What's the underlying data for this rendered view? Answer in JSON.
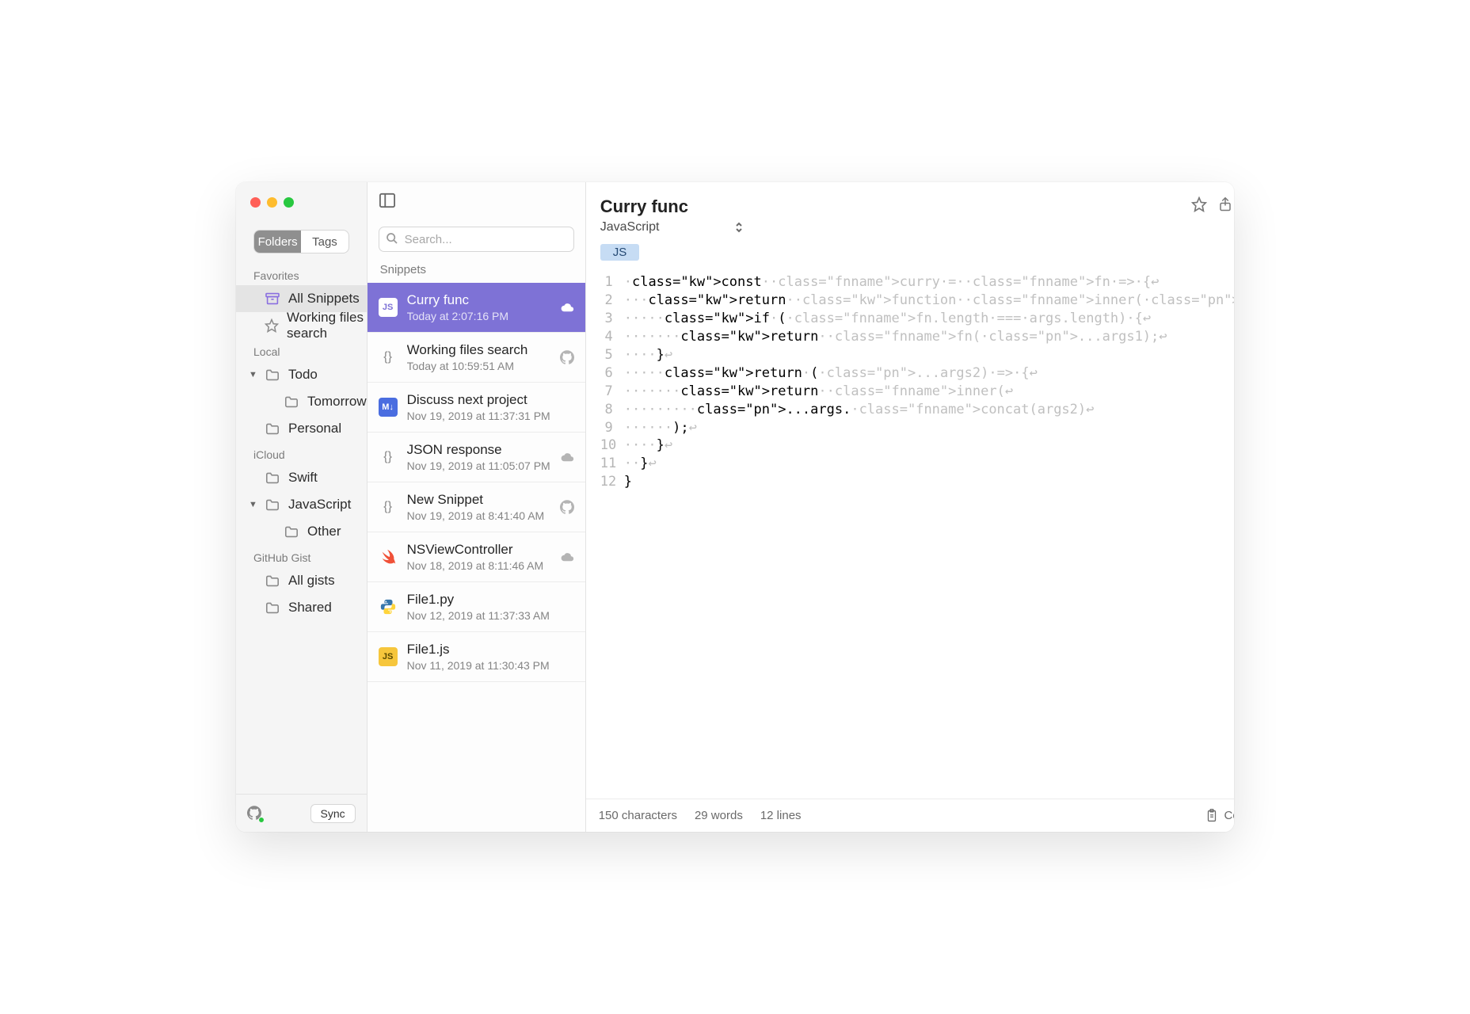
{
  "sidebar": {
    "tabs": {
      "folders": "Folders",
      "tags": "Tags"
    },
    "sections": {
      "favorites": "Favorites",
      "local": "Local",
      "icloud": "iCloud",
      "gist": "GitHub Gist"
    },
    "favorites": [
      {
        "label": "All Snippets",
        "icon": "box"
      },
      {
        "label": "Working files search",
        "icon": "star"
      }
    ],
    "local": [
      {
        "label": "Todo",
        "expandable": true,
        "expanded": true
      },
      {
        "label": "Tomorrow",
        "level": 2
      },
      {
        "label": "Personal",
        "level": 1
      }
    ],
    "icloud": [
      {
        "label": "Swift"
      },
      {
        "label": "JavaScript",
        "expandable": true,
        "expanded": true
      },
      {
        "label": "Other",
        "level": 2
      }
    ],
    "gist": [
      {
        "label": "All gists"
      },
      {
        "label": "Shared"
      }
    ],
    "sync_label": "Sync"
  },
  "list": {
    "search_placeholder": "Search...",
    "header": "Snippets",
    "items": [
      {
        "title": "Curry func",
        "sub": "Today at 2:07:16 PM",
        "badge": "js",
        "badge_text": "JS",
        "glyph": "cloud",
        "selected": true
      },
      {
        "title": "Working files search",
        "sub": "Today at 10:59:51 AM",
        "badge": "braces",
        "badge_text": "{}",
        "glyph": "github"
      },
      {
        "title": "Discuss next project",
        "sub": "Nov 19, 2019 at 11:37:31 PM",
        "badge": "md",
        "badge_text": "M↓"
      },
      {
        "title": "JSON response",
        "sub": "Nov 19, 2019 at 11:05:07 PM",
        "badge": "braces",
        "badge_text": "{}",
        "glyph": "cloud"
      },
      {
        "title": "New Snippet",
        "sub": "Nov 19, 2019 at 8:41:40 AM",
        "badge": "braces",
        "badge_text": "{}",
        "glyph": "github"
      },
      {
        "title": "NSViewController",
        "sub": "Nov 18, 2019 at 8:11:46 AM",
        "badge": "swift",
        "badge_text": "",
        "glyph": "cloud"
      },
      {
        "title": "File1.py",
        "sub": "Nov 12, 2019 at 11:37:33 AM",
        "badge": "py",
        "badge_text": ""
      },
      {
        "title": "File1.js",
        "sub": "Nov 11, 2019 at 11:30:43 PM",
        "badge": "js",
        "badge_text": "JS"
      }
    ]
  },
  "editor": {
    "title": "Curry func",
    "language": "JavaScript",
    "tag": "JS",
    "code_lines": [
      "const curry = fn => {",
      "  return function inner(...args) {",
      "    if (fn.length === args.length) {",
      "      return fn(...args1);",
      "    }",
      "    return (...args2) => {",
      "      return inner(",
      "        ...args.concat(args2)",
      "      );",
      "    }",
      "  }",
      "}"
    ],
    "footer": {
      "chars": "150 characters",
      "words": "29 words",
      "lines": "12 lines",
      "copy": "Copy to clipboard"
    }
  }
}
